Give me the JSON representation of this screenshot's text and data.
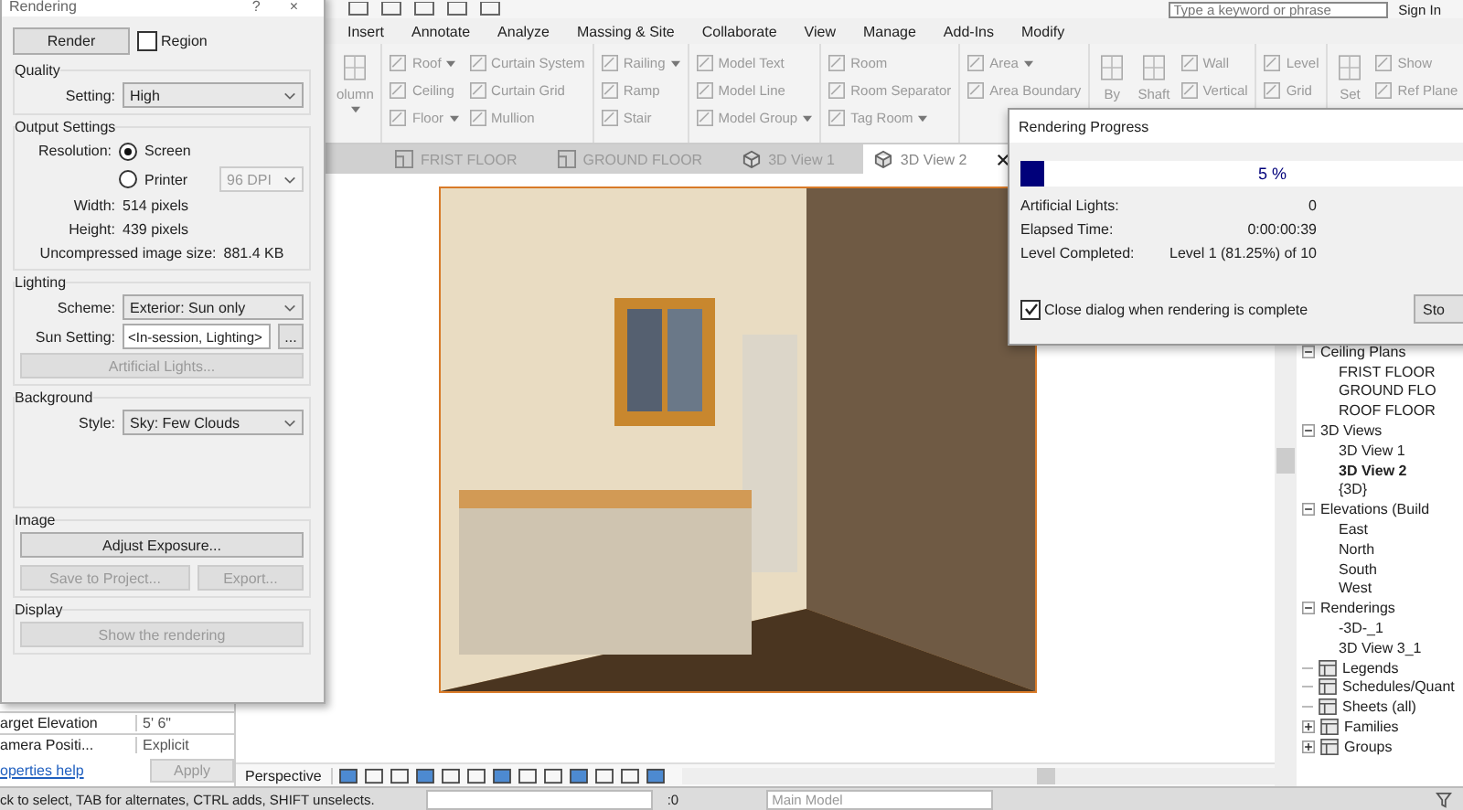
{
  "top_bar": {
    "search_placeholder": "Type a keyword or phrase",
    "sign_in": "Sign In"
  },
  "menu_tabs": [
    "Insert",
    "Annotate",
    "Analyze",
    "Massing & Site",
    "Collaborate",
    "View",
    "Manage",
    "Add-Ins",
    "Modify"
  ],
  "ribbon": {
    "panels": [
      {
        "tools": [
          {
            "label": "olumn",
            "kind": "large",
            "dropdown": true
          }
        ]
      },
      {
        "tools": [
          {
            "label": "Roof",
            "kind": "small",
            "dropdown": true
          },
          {
            "label": "Ceiling",
            "kind": "small",
            "dropdown": false
          },
          {
            "label": "Floor",
            "kind": "small",
            "dropdown": true
          },
          {
            "label": "Curtain System",
            "kind": "small",
            "dropdown": false
          },
          {
            "label": "Curtain Grid",
            "kind": "small",
            "dropdown": false
          },
          {
            "label": "Mullion",
            "kind": "small",
            "dropdown": false
          }
        ]
      },
      {
        "tools": [
          {
            "label": "Railing",
            "kind": "small",
            "dropdown": true
          },
          {
            "label": "Ramp",
            "kind": "small",
            "dropdown": false
          },
          {
            "label": "Stair",
            "kind": "small",
            "dropdown": false
          }
        ]
      },
      {
        "tools": [
          {
            "label": "Model Text",
            "kind": "small",
            "dropdown": false
          },
          {
            "label": "Model Line",
            "kind": "small",
            "dropdown": false
          },
          {
            "label": "Model Group",
            "kind": "small",
            "dropdown": true
          }
        ]
      },
      {
        "tools": [
          {
            "label": "Room",
            "kind": "small",
            "dropdown": false
          },
          {
            "label": "Room Separator",
            "kind": "small",
            "dropdown": false
          },
          {
            "label": "Tag Room",
            "kind": "small",
            "dropdown": true
          }
        ]
      },
      {
        "tools": [
          {
            "label": "Area",
            "kind": "small",
            "dropdown": true
          },
          {
            "label": "Area Boundary",
            "kind": "small",
            "dropdown": false
          }
        ]
      },
      {
        "tools": [
          {
            "label": "By",
            "kind": "large",
            "dropdown": false
          },
          {
            "label": "Shaft",
            "kind": "large",
            "dropdown": false
          },
          {
            "label": "Wall",
            "kind": "small",
            "dropdown": false
          },
          {
            "label": "Vertical",
            "kind": "small",
            "dropdown": false
          }
        ]
      },
      {
        "tools": [
          {
            "label": "Level",
            "kind": "small",
            "dropdown": false
          },
          {
            "label": "Grid",
            "kind": "small",
            "dropdown": false
          }
        ]
      },
      {
        "tools": [
          {
            "label": "Set",
            "kind": "large",
            "dropdown": false
          },
          {
            "label": "Show",
            "kind": "small",
            "dropdown": false
          },
          {
            "label": "Ref Plane",
            "kind": "small",
            "dropdown": false
          }
        ]
      }
    ]
  },
  "view_tabs": [
    {
      "label": "FRIST FLOOR",
      "kind": "plan",
      "selected": false
    },
    {
      "label": "GROUND FLOOR",
      "kind": "plan",
      "selected": false
    },
    {
      "label": "3D View 1",
      "kind": "perspective",
      "selected": false
    },
    {
      "label": "3D View 2",
      "kind": "perspective",
      "selected": true
    }
  ],
  "properties": {
    "rows": [
      {
        "name": "arget Elevation",
        "value": "5' 6\""
      },
      {
        "name": "amera Positi...",
        "value": "Explicit"
      }
    ],
    "help_link": "operties help",
    "apply_button": {
      "label": "Apply",
      "disabled": true
    }
  },
  "view_bar": {
    "label": "Perspective"
  },
  "status_bar": {
    "hint": "ck to select, TAB for alternates, CTRL adds, SHIFT unselects.",
    "counter": ":0",
    "workset": "Main Model"
  },
  "project_browser": {
    "tree": [
      {
        "label": "Ceiling Plans",
        "icon": false,
        "expanded": true,
        "selected": false,
        "children": [
          {
            "label": "FRIST FLOOR",
            "selected": false
          },
          {
            "label": "GROUND FLO",
            "selected": false
          },
          {
            "label": "ROOF FLOOR",
            "selected": false
          }
        ]
      },
      {
        "label": "3D Views",
        "icon": false,
        "expanded": true,
        "selected": false,
        "children": [
          {
            "label": "3D View 1",
            "selected": false
          },
          {
            "label": "3D View 2",
            "selected": true
          },
          {
            "label": "{3D}",
            "selected": false
          }
        ]
      },
      {
        "label": "Elevations (Build",
        "icon": false,
        "expanded": true,
        "selected": false,
        "children": [
          {
            "label": "East",
            "selected": false
          },
          {
            "label": "North",
            "selected": false
          },
          {
            "label": "South",
            "selected": false
          },
          {
            "label": "West",
            "selected": false
          }
        ]
      },
      {
        "label": "Renderings",
        "icon": false,
        "expanded": true,
        "selected": false,
        "children": [
          {
            "label": "-3D-_1",
            "selected": false
          },
          {
            "label": "3D View 3_1",
            "selected": false
          }
        ]
      },
      {
        "label": "Legends",
        "icon": true,
        "selected": false
      },
      {
        "label": "Schedules/Quant",
        "icon": true,
        "selected": false
      },
      {
        "label": "Sheets (all)",
        "icon": true,
        "selected": false
      },
      {
        "label": "Families",
        "icon": true,
        "expanded": false,
        "selected": false
      },
      {
        "label": "Groups",
        "icon": true,
        "expanded": false,
        "selected": false
      }
    ]
  },
  "render_dialog": {
    "title": "Rendering",
    "help": "?",
    "close": "×",
    "render_button": "Render",
    "region": {
      "label": "Region",
      "checked": false
    },
    "quality": {
      "title": "Quality",
      "setting_label": "Setting:",
      "setting": "High"
    },
    "output": {
      "title": "Output Settings",
      "resolution_label": "Resolution:",
      "options": [
        {
          "label": "Screen",
          "selected": true
        },
        {
          "label": "Printer",
          "selected": false
        }
      ],
      "dpi": {
        "value": "96 DPI",
        "disabled": true
      },
      "width_label": "Width:",
      "width": "514 pixels",
      "height_label": "Height:",
      "height": "439 pixels",
      "size_label": "Uncompressed image size:",
      "size": "881.4 KB"
    },
    "lighting": {
      "title": "Lighting",
      "scheme_label": "Scheme:",
      "scheme": "Exterior: Sun only",
      "sun_label": "Sun Setting:",
      "sun": "<In-session, Lighting>",
      "more": "...",
      "lights_button": {
        "label": "Artificial Lights...",
        "disabled": true
      }
    },
    "background": {
      "title": "Background",
      "style_label": "Style:",
      "style": "Sky: Few Clouds"
    },
    "image": {
      "title": "Image",
      "buttons": [
        {
          "label": "Adjust Exposure...",
          "disabled": false
        },
        {
          "label": "Save to Project...",
          "disabled": true
        },
        {
          "label": "Export...",
          "disabled": true
        }
      ]
    },
    "display": {
      "title": "Display",
      "button": {
        "label": "Show the rendering",
        "disabled": true
      }
    }
  },
  "progress_dialog": {
    "title": "Rendering Progress",
    "level": 0.05,
    "percent": "5 %",
    "rows": [
      {
        "label": "Artificial Lights:",
        "value": "0"
      },
      {
        "label": "Elapsed Time:",
        "value": "0:00:00:39"
      },
      {
        "label": "Level Completed:",
        "value": "Level 1 (81.25%) of 10"
      }
    ],
    "close_option": {
      "label": "Close dialog when rendering is complete",
      "checked": true
    },
    "stop_button": "Sto"
  }
}
